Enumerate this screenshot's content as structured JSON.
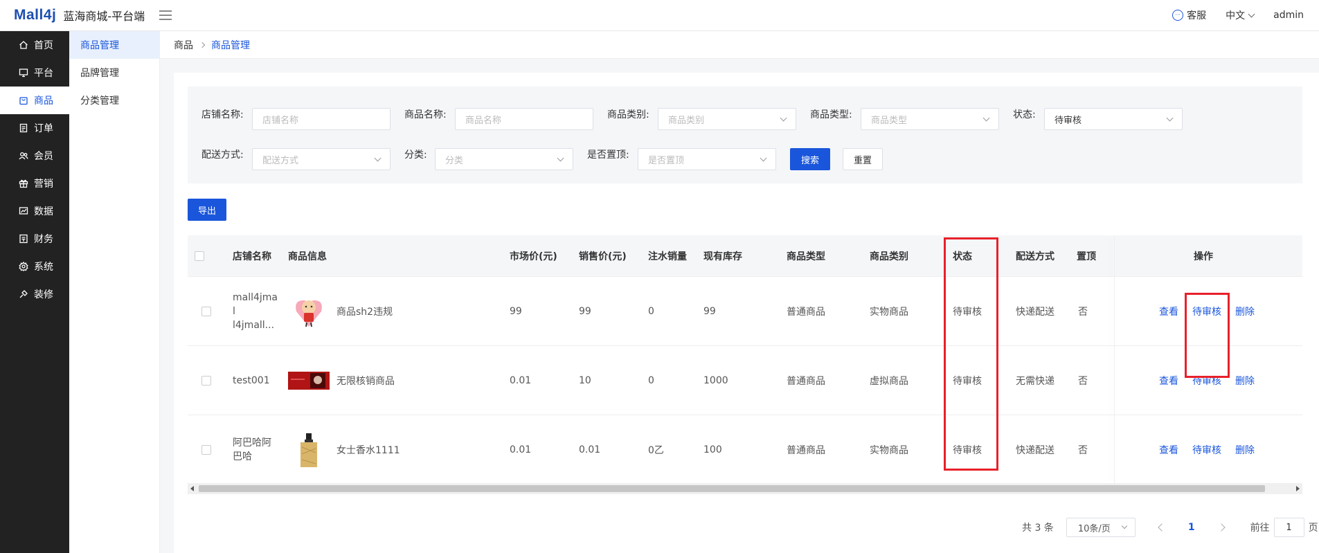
{
  "header": {
    "logo": "Mall4j",
    "title": "蓝海商城-平台端",
    "support": "客服",
    "language": "中文",
    "user": "admin"
  },
  "sidebar": {
    "items": [
      {
        "label": "首页",
        "icon": "home-icon"
      },
      {
        "label": "平台",
        "icon": "monitor-icon"
      },
      {
        "label": "商品",
        "icon": "bag-icon"
      },
      {
        "label": "订单",
        "icon": "document-icon"
      },
      {
        "label": "会员",
        "icon": "users-icon"
      },
      {
        "label": "营销",
        "icon": "gift-icon"
      },
      {
        "label": "数据",
        "icon": "chart-icon"
      },
      {
        "label": "财务",
        "icon": "wallet-icon"
      },
      {
        "label": "系统",
        "icon": "gear-icon"
      },
      {
        "label": "装修",
        "icon": "brush-icon"
      }
    ],
    "active_index": 2
  },
  "submenu": {
    "items": [
      "商品管理",
      "品牌管理",
      "分类管理"
    ],
    "active_index": 0
  },
  "breadcrumb": {
    "parent": "商品",
    "current": "商品管理"
  },
  "filters": {
    "shop_name": {
      "label": "店铺名称:",
      "placeholder": "店铺名称"
    },
    "product_name": {
      "label": "商品名称:",
      "placeholder": "商品名称"
    },
    "product_category": {
      "label": "商品类别:",
      "placeholder": "商品类别"
    },
    "product_type": {
      "label": "商品类型:",
      "placeholder": "商品类型"
    },
    "status": {
      "label": "状态:",
      "value": "待审核"
    },
    "delivery": {
      "label": "配送方式:",
      "placeholder": "配送方式"
    },
    "category": {
      "label": "分类:",
      "placeholder": "分类"
    },
    "pinned": {
      "label": "是否置顶:",
      "placeholder": "是否置顶"
    },
    "search_button": "搜索",
    "reset_button": "重置"
  },
  "export_button": "导出",
  "table": {
    "headers": {
      "shop": "店铺名称",
      "info": "商品信息",
      "market_price": "市场价(元)",
      "sale_price": "销售价(元)",
      "fake_sales": "注水销量",
      "stock": "现有库存",
      "type": "商品类型",
      "category": "商品类别",
      "status": "状态",
      "delivery": "配送方式",
      "top": "置顶",
      "ops": "操作"
    },
    "rows": [
      {
        "shop": [
          "mall4jmal",
          "l4jmall..."
        ],
        "name": "商品sh2违规",
        "market_price": "99",
        "sale_price": "99",
        "fake_sales": "0",
        "stock": "99",
        "type": "普通商品",
        "category": "实物商品",
        "status": "待审核",
        "delivery": "快递配送",
        "top": "否",
        "op_view": "查看",
        "op_audit": "待审核",
        "op_delete": "删除"
      },
      {
        "shop": [
          "test001"
        ],
        "name": "无限核销商品",
        "market_price": "0.01",
        "sale_price": "10",
        "fake_sales": "0",
        "stock": "1000",
        "type": "普通商品",
        "category": "虚拟商品",
        "status": "待审核",
        "delivery": "无需快递",
        "top": "否",
        "op_view": "查看",
        "op_audit": "待审核",
        "op_delete": "删除"
      },
      {
        "shop": [
          "阿巴哈阿",
          "巴哈"
        ],
        "name": "女士香水1111",
        "market_price": "0.01",
        "sale_price": "0.01",
        "fake_sales": "0乙",
        "stock": "100",
        "type": "普通商品",
        "category": "实物商品",
        "status": "待审核",
        "delivery": "快递配送",
        "top": "否",
        "op_view": "查看",
        "op_audit": "待审核",
        "op_delete": "删除"
      }
    ]
  },
  "pagination": {
    "total": "共 3 条",
    "page_size": "10条/页",
    "current_page": "1",
    "goto_label": "前往",
    "goto_value": "1",
    "page_suffix": "页"
  },
  "colors": {
    "primary": "#1a56db",
    "sidebar_bg": "#222222",
    "highlight": "#e8202a"
  }
}
